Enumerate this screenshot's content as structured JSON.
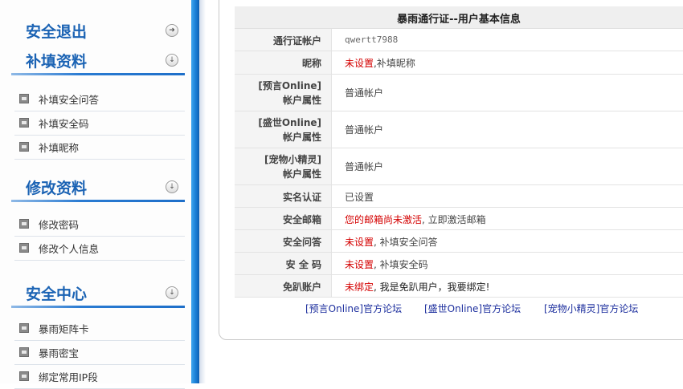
{
  "sidebar": {
    "sections": [
      {
        "title": "安全退出",
        "button_icon": "arrow-right-icon",
        "items": []
      },
      {
        "title": "补填资料",
        "button_icon": "chevron-down-icon",
        "items": [
          "补填安全问答",
          "补填安全码",
          "补填昵称"
        ]
      },
      {
        "title": "修改资料",
        "button_icon": "chevron-down-icon",
        "items": [
          "修改密码",
          "修改个人信息"
        ]
      },
      {
        "title": "安全中心",
        "button_icon": "chevron-down-icon",
        "items": [
          "暴雨矩阵卡",
          "暴雨密宝",
          "绑定常用IP段"
        ]
      }
    ]
  },
  "panel": {
    "title": "暴雨通行证--用户基本信息",
    "rows": {
      "account": {
        "label": "通行证帐户",
        "value": "qwertt7988"
      },
      "nickname": {
        "label": "昵称",
        "status": "未设置",
        "action": ",补填昵称"
      },
      "yuyan": {
        "label_line1": "[预言Online]",
        "label_line2": "帐户属性",
        "value": "普通帐户"
      },
      "shengshi": {
        "label_line1": "[盛世Online]",
        "label_line2": "帐户属性",
        "value": "普通帐户"
      },
      "pet": {
        "label_line1": "[宠物小精灵]",
        "label_line2": "帐户属性",
        "value": "普通帐户"
      },
      "realname": {
        "label": "实名认证",
        "value": "已设置"
      },
      "email": {
        "label": "安全邮箱",
        "status": "您的邮箱尚未激活",
        "action": ", 立即激活邮箱"
      },
      "qa": {
        "label": "安全问答",
        "status": "未设置",
        "action": ", 补填安全问答"
      },
      "code": {
        "label": "安 全 码",
        "status": "未设置",
        "action": ", 补填安全码"
      },
      "free": {
        "label": "免趴账户",
        "status": "未绑定",
        "action": ", 我是免趴用户，我要绑定!"
      }
    },
    "footer_links": [
      "[预言Online]官方论坛",
      "[盛世Online]官方论坛",
      "[宠物小精灵]官方论坛"
    ]
  },
  "colors": {
    "accent_blue": "#1b63b4",
    "sidebar_edge": "#1a7fd6",
    "alert_red": "#d40000",
    "link_blue": "#1d2f9e"
  }
}
